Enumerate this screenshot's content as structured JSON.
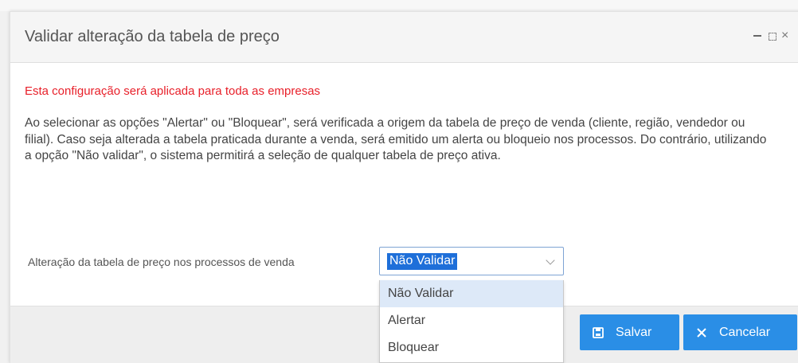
{
  "dialog": {
    "title": "Validar alteração da tabela de preço",
    "controls": {
      "minimize_icon": "minimize-icon",
      "maximize_icon": "maximize-icon",
      "close_label": "×"
    },
    "warning": "Esta configuração será aplicada para toda as empresas",
    "description": "Ao selecionar as opções \"Alertar\" ou \"Bloquear\", será verificada a origem da tabela de preço de venda (cliente, região, vendedor ou filial). Caso seja alterada a tabela praticada durante a venda, será emitido um alerta ou bloqueio nos processos. Do contrário, utilizando a opção \"Não validar\", o sistema permitirá a seleção de qualquer tabela de preço ativa.",
    "field": {
      "label": "Alteração da tabela de preço nos processos de venda",
      "selected_value": "Não Validar",
      "options": [
        "Não Validar",
        "Alertar",
        "Bloquear"
      ]
    },
    "buttons": {
      "save_label": "Salvar",
      "cancel_label": "Cancelar"
    }
  },
  "colors": {
    "warning": "#e8202a",
    "button": "#2a8ee6",
    "selection": "#1e6fd9",
    "option_highlight": "#dde9f8"
  }
}
